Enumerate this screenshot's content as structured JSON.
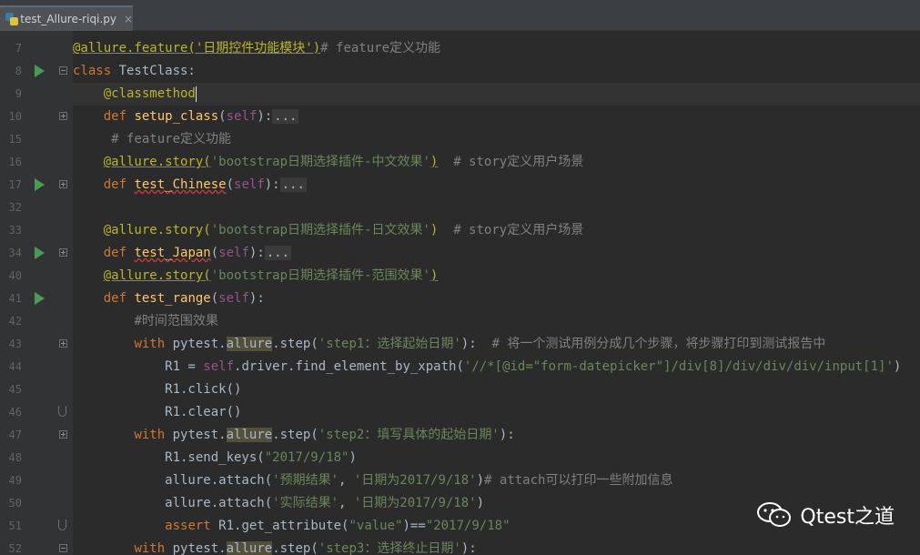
{
  "tab": {
    "label": "test_Allure-riqi.py",
    "close": "×"
  },
  "watermark": {
    "text": "Qtest之道"
  },
  "lines": [
    {
      "num": "7",
      "tokens": [
        {
          "c": "dec",
          "t": "@allure.feature('日期控件功能模块')"
        },
        {
          "c": "cm",
          "t": "# feature定义功能"
        }
      ]
    },
    {
      "num": "8",
      "tokens": [
        {
          "c": "kw",
          "t": "class "
        },
        {
          "c": "plain",
          "t": "TestClass:"
        }
      ]
    },
    {
      "num": "9",
      "tokens": [
        {
          "c": "plain",
          "t": "    "
        },
        {
          "c": "dec",
          "t": "@classmethod"
        }
      ]
    },
    {
      "num": "10",
      "tokens": [
        {
          "c": "plain",
          "t": "    "
        },
        {
          "c": "kw",
          "t": "def "
        },
        {
          "c": "fn",
          "t": "setup_class"
        },
        {
          "c": "plain",
          "t": "("
        },
        {
          "c": "slf",
          "t": "self"
        },
        {
          "c": "plain",
          "t": "):"
        },
        {
          "c": "plain",
          "t": "..."
        }
      ]
    },
    {
      "num": "15",
      "tokens": [
        {
          "c": "plain",
          "t": "     "
        },
        {
          "c": "cm",
          "t": "# feature定义功能"
        }
      ]
    },
    {
      "num": "16",
      "tokens": [
        {
          "c": "plain",
          "t": "    "
        },
        {
          "c": "dec",
          "t": "@allure.story("
        },
        {
          "c": "str",
          "t": "'bootstrap日期选择插件-中文效果'"
        },
        {
          "c": "dec",
          "t": ")"
        },
        {
          "c": "plain",
          "t": "  "
        },
        {
          "c": "cm",
          "t": "# story定义用户场景"
        }
      ]
    },
    {
      "num": "17",
      "tokens": [
        {
          "c": "plain",
          "t": "    "
        },
        {
          "c": "kw",
          "t": "def "
        },
        {
          "c": "fn",
          "t": "test_Chinese"
        },
        {
          "c": "plain",
          "t": "("
        },
        {
          "c": "slf",
          "t": "self"
        },
        {
          "c": "plain",
          "t": "):"
        },
        {
          "c": "plain",
          "t": "..."
        }
      ]
    },
    {
      "num": "32",
      "tokens": []
    },
    {
      "num": "33",
      "tokens": [
        {
          "c": "plain",
          "t": "    "
        },
        {
          "c": "dec",
          "t": "@allure.story("
        },
        {
          "c": "str",
          "t": "'bootstrap日期选择插件-日文效果'"
        },
        {
          "c": "dec",
          "t": ")"
        },
        {
          "c": "plain",
          "t": "  "
        },
        {
          "c": "cm",
          "t": "# story定义用户场景"
        }
      ]
    },
    {
      "num": "34",
      "tokens": [
        {
          "c": "plain",
          "t": "    "
        },
        {
          "c": "kw",
          "t": "def "
        },
        {
          "c": "fn",
          "t": "test_Japan"
        },
        {
          "c": "plain",
          "t": "("
        },
        {
          "c": "slf",
          "t": "self"
        },
        {
          "c": "plain",
          "t": "):"
        },
        {
          "c": "plain",
          "t": "..."
        }
      ]
    },
    {
      "num": "40",
      "tokens": [
        {
          "c": "plain",
          "t": "    "
        },
        {
          "c": "dec",
          "t": "@allure.story("
        },
        {
          "c": "str",
          "t": "'bootstrap日期选择插件-范围效果'"
        },
        {
          "c": "dec",
          "t": ")"
        }
      ]
    },
    {
      "num": "41",
      "tokens": [
        {
          "c": "plain",
          "t": "    "
        },
        {
          "c": "kw",
          "t": "def "
        },
        {
          "c": "fn",
          "t": "test_range"
        },
        {
          "c": "plain",
          "t": "("
        },
        {
          "c": "slf",
          "t": "self"
        },
        {
          "c": "plain",
          "t": "):"
        }
      ]
    },
    {
      "num": "42",
      "tokens": [
        {
          "c": "plain",
          "t": "        "
        },
        {
          "c": "cm",
          "t": "#时间范围效果"
        }
      ]
    },
    {
      "num": "43",
      "tokens": [
        {
          "c": "plain",
          "t": "        "
        },
        {
          "c": "kw",
          "t": "with "
        },
        {
          "c": "plain",
          "t": "pytest."
        },
        {
          "c": "plain",
          "t": "allure"
        },
        {
          "c": "plain",
          "t": ".step("
        },
        {
          "c": "str",
          "t": "'step1：选择起始日期'"
        },
        {
          "c": "plain",
          "t": "):  "
        },
        {
          "c": "cm",
          "t": "# 将一个测试用例分成几个步骤，将步骤打印到测试报告中"
        }
      ]
    },
    {
      "num": "44",
      "tokens": [
        {
          "c": "plain",
          "t": "            R1 = "
        },
        {
          "c": "slf",
          "t": "self"
        },
        {
          "c": "plain",
          "t": ".driver.find_element_by_xpath("
        },
        {
          "c": "str",
          "t": "'//*[@id=\"form-datepicker\"]/div[8]/div/div/div/input[1]'"
        },
        {
          "c": "plain",
          "t": ")"
        }
      ]
    },
    {
      "num": "45",
      "tokens": [
        {
          "c": "plain",
          "t": "            R1.click()"
        }
      ]
    },
    {
      "num": "46",
      "tokens": [
        {
          "c": "plain",
          "t": "            R1.clear()"
        }
      ]
    },
    {
      "num": "47",
      "tokens": [
        {
          "c": "plain",
          "t": "        "
        },
        {
          "c": "kw",
          "t": "with "
        },
        {
          "c": "plain",
          "t": "pytest."
        },
        {
          "c": "plain",
          "t": "allure"
        },
        {
          "c": "plain",
          "t": ".step("
        },
        {
          "c": "str",
          "t": "'step2：填写具体的起始日期'"
        },
        {
          "c": "plain",
          "t": "):"
        }
      ]
    },
    {
      "num": "48",
      "tokens": [
        {
          "c": "plain",
          "t": "            R1.send_keys("
        },
        {
          "c": "str",
          "t": "\"2017/9/18\""
        },
        {
          "c": "plain",
          "t": ")"
        }
      ]
    },
    {
      "num": "49",
      "tokens": [
        {
          "c": "plain",
          "t": "            allure.attach("
        },
        {
          "c": "str",
          "t": "'预期结果'"
        },
        {
          "c": "plain",
          "t": ", "
        },
        {
          "c": "str",
          "t": "'日期为2017/9/18'"
        },
        {
          "c": "plain",
          "t": ")"
        },
        {
          "c": "cm",
          "t": "# attach可以打印一些附加信息"
        }
      ]
    },
    {
      "num": "50",
      "tokens": [
        {
          "c": "plain",
          "t": "            allure.attach("
        },
        {
          "c": "str",
          "t": "'实际结果'"
        },
        {
          "c": "plain",
          "t": ", "
        },
        {
          "c": "str",
          "t": "'日期为2017/9/18'"
        },
        {
          "c": "plain",
          "t": ")"
        }
      ]
    },
    {
      "num": "51",
      "tokens": [
        {
          "c": "plain",
          "t": "            "
        },
        {
          "c": "kw",
          "t": "assert "
        },
        {
          "c": "plain",
          "t": "R1.get_attribute("
        },
        {
          "c": "str",
          "t": "\"value\""
        },
        {
          "c": "plain",
          "t": ")=="
        },
        {
          "c": "str",
          "t": "\"2017/9/18\""
        }
      ]
    },
    {
      "num": "52",
      "tokens": [
        {
          "c": "plain",
          "t": "        "
        },
        {
          "c": "kw",
          "t": "with "
        },
        {
          "c": "plain",
          "t": "pytest."
        },
        {
          "c": "plain",
          "t": "allure"
        },
        {
          "c": "plain",
          "t": ".step("
        },
        {
          "c": "str",
          "t": "'step3：选择终止日期'"
        },
        {
          "c": "plain",
          "t": "):"
        }
      ]
    }
  ]
}
